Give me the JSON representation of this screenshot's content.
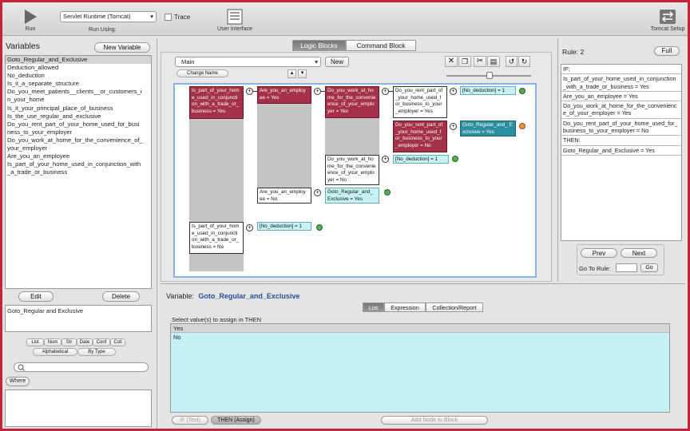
{
  "toolbar": {
    "run_label": "Run",
    "runtime_value": "Servlet Runtime (Tomcat)",
    "run_using_label": "Run Using:",
    "trace_label": "Trace",
    "ui_label": "User Interface",
    "tomcat_label": "Tomcat Setup"
  },
  "variables": {
    "title": "Variables",
    "new_button": "New Variable",
    "items": [
      "Goto_Regular_and_Exclusive",
      "Deduction_allowed",
      "No_deduction",
      "Is_it_a_separate_structure",
      "Do_you_meet_patients__clients__or_customers_i",
      "n_your_home",
      "Is_it_your_principal_place_of_business",
      "Is_the_use_regular_and_exclusive",
      "Do_you_rent_part_of_your_home_used_for_busi",
      "ness_to_your_employer",
      "Do_you_work_at_home_for_the_convenience_of_",
      "your_employer",
      "Are_you_an_employee",
      "Is_part_of_your_home_used_in_conjunction_with",
      "_a_trade_or_business"
    ],
    "edit_button": "Edit",
    "delete_button": "Delete",
    "selected_text": "Goto_Regular and Exclusive",
    "filter_buttons": [
      "List",
      "Num",
      "Str",
      "Date",
      "Conf",
      "Coll"
    ],
    "sort_buttons": [
      "Alphabetical",
      "By Type"
    ],
    "search_placeholder": "",
    "where_button": "Where"
  },
  "logic": {
    "tabs": [
      "Logic Blocks",
      "Command Block"
    ],
    "block_select": "Main",
    "new_button": "New",
    "change_name_button": "Change Name",
    "nodes": {
      "n1": "Is_part_of_your_hom e_used_in_conjuncti on_with_a_trade_or_ business = Yes",
      "n2": "Are_you_an_employ ee = Yes",
      "n3": "Do_you_work_at_ho me_for_the_convenie ence_of_your_emplo yer = Yes",
      "n4": "Do_you_rent_part_of _your_home_used_f or_business_to_your _employer = Yes",
      "n5": "[No_deduction] = 1",
      "n6": "Do_you_rent_part_of _your_home_used_f or_business_to_your _employer = No",
      "n7": "Goto_Regular_and_ Exclusive = Yes",
      "n8": "Do_you_work_at_ho me_for_the_convenie ence_of_your_emplo yer = No",
      "n9": "[No_deduction] = 1",
      "n10": "Are_you_an_employ ee = No",
      "n11": "Goto_Regular_and_ Exclusive = Yes",
      "n12": "Is_part_of_your_hom e_used_in_conjuncti on_with_a_trade_or_ business = No",
      "n13": "[No_deduction] = 1"
    }
  },
  "rule": {
    "title": "Rule: 2",
    "full_button": "Full",
    "rows": [
      "IF:",
      "Is_part_of_your_home_used_in_conjunction _with_a_trade_or_business = Yes",
      "Are_you_an_employee = Yes",
      "Do_you_work_at_home_for_the_convenienc e_of_your_employer = Yes",
      "Do_you_rent_part_of_your_home_used_for_ business_to_your_employer = No",
      "THEN:",
      "Goto_Regular_and_Exclusive = Yes"
    ],
    "prev_button": "Prev",
    "next_button": "Next",
    "goto_label": "Go To Rule:",
    "go_button": "Go"
  },
  "variable_panel": {
    "label": "Variable:",
    "name": "Goto_Regular_and_Exclusive",
    "tabs": [
      "List",
      "Expression",
      "Collection/Report"
    ],
    "instruction": "Select value(s) to assign in THEN",
    "values": [
      "Yes",
      "No"
    ],
    "if_button": "IF (Test)",
    "then_button": "THEN (Assign)",
    "add_node_button": "Add Node to Block"
  }
}
